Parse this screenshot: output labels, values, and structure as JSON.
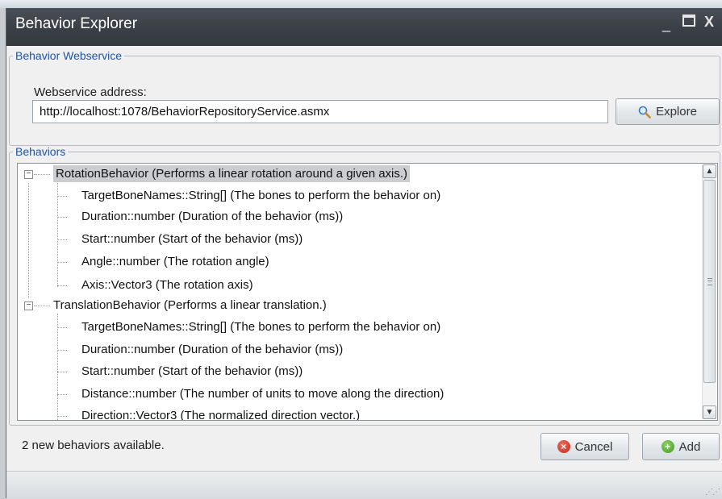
{
  "window": {
    "title": "Behavior Explorer",
    "controls": {
      "minimize": "_",
      "close": "X"
    }
  },
  "webservice": {
    "group_label": "Behavior Webservice",
    "address_label": "Webservice address:",
    "address_value": "http://localhost:1078/BehaviorRepositoryService.asmx",
    "explore_label": "Explore"
  },
  "behaviors": {
    "group_label": "Behaviors",
    "tree": [
      {
        "label": "RotationBehavior (Performs a linear rotation around a given axis.)",
        "expanded": true,
        "selected": true,
        "children": [
          "TargetBoneNames::String[] (The bones to perform the behavior on)",
          "Duration::number (Duration of the behavior (ms))",
          "Start::number (Start of the behavior (ms))",
          "Angle::number (The rotation angle)",
          "Axis::Vector3 (The rotation axis)"
        ]
      },
      {
        "label": "TranslationBehavior (Performs a linear translation.)",
        "expanded": true,
        "selected": false,
        "children": [
          "TargetBoneNames::String[] (The bones to perform the behavior on)",
          "Duration::number (Duration of the behavior (ms))",
          "Start::number (Start of the behavior (ms))",
          "Distance::number (The number of units to move along the direction)",
          "Direction::Vector3 (The normalized direction vector.)"
        ]
      }
    ]
  },
  "footer": {
    "status": "2 new behaviors available.",
    "cancel_label": "Cancel",
    "add_label": "Add"
  },
  "colors": {
    "titlebar": "#3a3f46",
    "group_label": "#1f55a3",
    "selection": "#cbcdd1"
  },
  "icons": {
    "explore": "magnifier-icon",
    "cancel": "cancel-icon",
    "add": "add-icon"
  }
}
